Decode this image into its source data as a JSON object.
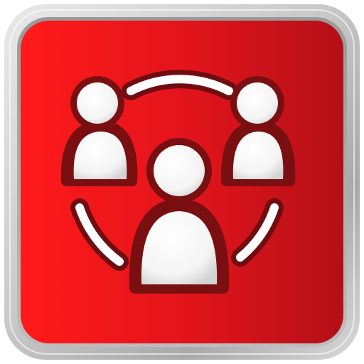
{
  "app_icon": {
    "icon_name": "group-people-icon",
    "colors": {
      "frame_light": "#e6e6e6",
      "frame_mid": "#bdbdbd",
      "frame_dark": "#8f8f8f",
      "red_left": "#ff1717",
      "red_right": "#b50f16",
      "outline_dark": "#7a0f12",
      "figure_white": "#ffffff",
      "figure_shadow": "#d6d6d6"
    }
  }
}
